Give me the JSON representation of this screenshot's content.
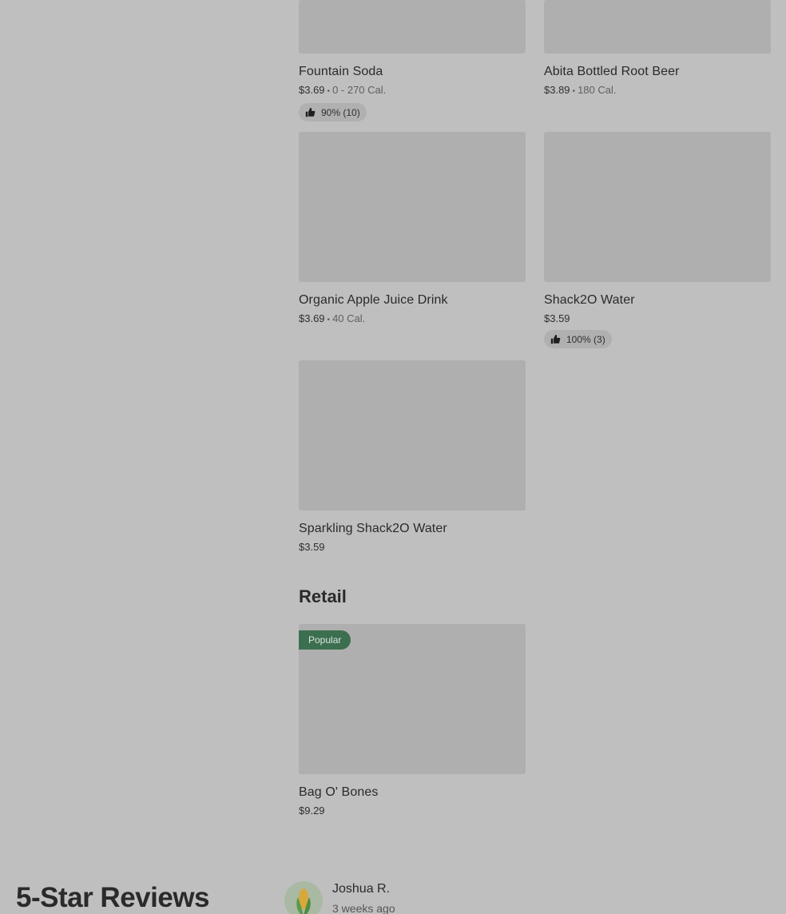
{
  "menu": {
    "items": [
      {
        "name": "Fountain Soda",
        "price": "$3.69",
        "calories": "0 - 270 Cal.",
        "rating": "90% (10)"
      },
      {
        "name": "Abita Bottled Root Beer",
        "price": "$3.89",
        "calories": "180 Cal.",
        "rating": ""
      },
      {
        "name": "Organic Apple Juice Drink",
        "price": "$3.69",
        "calories": "40 Cal.",
        "rating": ""
      },
      {
        "name": "Shack2O Water",
        "price": "$3.59",
        "calories": "",
        "rating": "100% (3)"
      },
      {
        "name": "Sparkling Shack2O Water",
        "price": "$3.59",
        "calories": "",
        "rating": ""
      }
    ],
    "dot": "•"
  },
  "retail": {
    "title": "Retail",
    "items": [
      {
        "name": "Bag O' Bones",
        "price": "$9.29",
        "badge": "Popular"
      }
    ]
  },
  "reviews": {
    "title": "5-Star Reviews",
    "first": {
      "name": "Joshua R.",
      "time": "3 weeks ago",
      "avatar_icon": "corn-icon"
    }
  },
  "colors": {
    "overlay_bg": "#bfbfbf",
    "image_placeholder": "#afafaf",
    "popular_badge": "#3c6e50"
  }
}
